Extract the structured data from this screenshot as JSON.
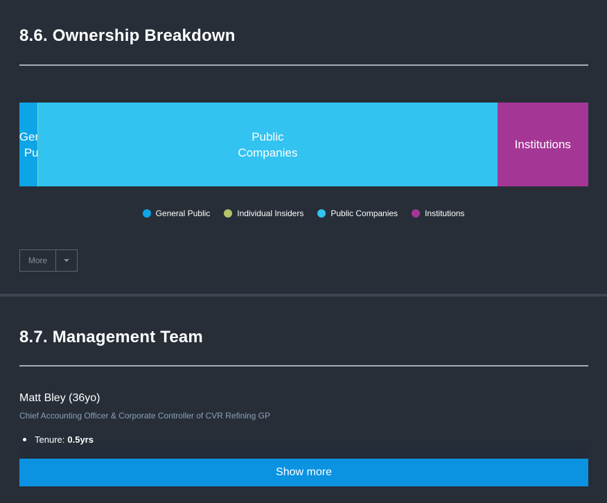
{
  "ownership": {
    "title": "8.6. Ownership Breakdown",
    "more_label": "More",
    "legend": [
      {
        "label": "General Public",
        "color": "#0ea5e6"
      },
      {
        "label": "Individual Insiders",
        "color": "#b5c26a"
      },
      {
        "label": "Public Companies",
        "color": "#32c3f0"
      },
      {
        "label": "Institutions",
        "color": "#a43796"
      }
    ]
  },
  "chart_data": {
    "type": "bar",
    "orientation": "horizontal-stacked",
    "unit": "%",
    "segments": [
      {
        "name": "General Public",
        "value": 3.2,
        "color": "#0ea5e6",
        "label": "General\nPublic"
      },
      {
        "name": "Individual Insiders",
        "value": 0.1,
        "color": "#b5c26a",
        "label": ""
      },
      {
        "name": "Public Companies",
        "value": 80.7,
        "color": "#32c3f0",
        "label": "Public\nCompanies"
      },
      {
        "name": "Institutions",
        "value": 16.0,
        "color": "#a43796",
        "label": "Institutions"
      }
    ]
  },
  "management": {
    "title": "8.7. Management Team",
    "person": {
      "name": "Matt Bley (36yo)",
      "role": "Chief Accounting Officer & Corporate Controller of CVR Refining GP",
      "tenure_label": "Tenure:",
      "tenure_value": "0.5yrs"
    },
    "show_more_label": "Show more"
  }
}
